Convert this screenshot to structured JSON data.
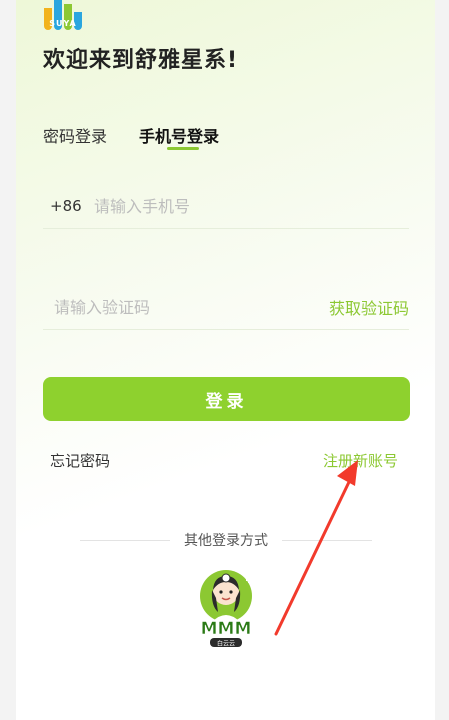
{
  "app": {
    "logo_text": "SUYA",
    "welcome": "欢迎来到舒雅星系!",
    "brand_colors": {
      "accent": "#8cc832",
      "button": "#8ed12e"
    }
  },
  "tabs": [
    {
      "label": "密码登录",
      "active": false
    },
    {
      "label": "手机号登录",
      "active": true
    }
  ],
  "phone": {
    "country_code": "+86",
    "placeholder": "请输入手机号",
    "value": ""
  },
  "code": {
    "placeholder": "请输入验证码",
    "value": "",
    "get_code_label": "获取验证码"
  },
  "login_button": "登录",
  "forgot_label": "忘记密码",
  "register_label": "注册新账号",
  "other_login": {
    "label": "其他登录方式",
    "provider_icon": "mmm-avatar-icon",
    "provider_text": "MMM",
    "provider_subtext": "白云云"
  },
  "annotation": {
    "type": "red-arrow",
    "points_to": "register-link"
  }
}
